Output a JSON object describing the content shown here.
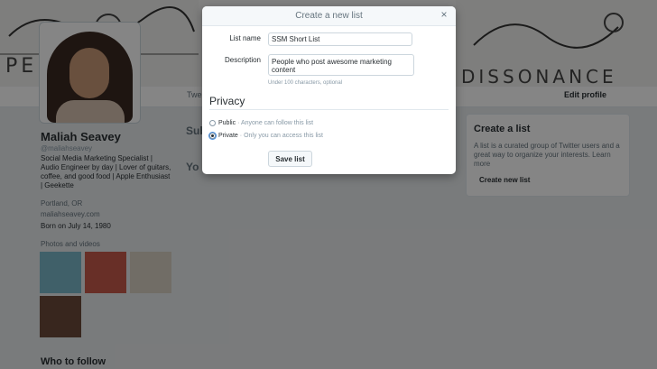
{
  "modal": {
    "title": "Create a new list",
    "close_glyph": "×",
    "list_name_label": "List name",
    "list_name_value": "SSM Short List",
    "description_label": "Description",
    "description_value": "People who post awesome marketing content",
    "description_hint": "Under 100 characters, optional",
    "privacy_title": "Privacy",
    "public_label": "Public",
    "public_sub": "· Anyone can follow this list",
    "private_label": "Private",
    "private_sub": "· Only you can access this list",
    "selected_privacy": "private",
    "save_label": "Save list"
  },
  "profile": {
    "name": "Maliah Seavey",
    "edit_profile_label": "Edit profile",
    "born": "Born on July 14, 1980",
    "who_to_follow": "Who to follow"
  },
  "sidebar_right": {
    "title": "Create a list",
    "text": "A list is a curated group of Twitter users and a great way to organize your interests. Learn more",
    "button": "Create new list"
  },
  "icons": {
    "close": "close-icon",
    "radio": "radio-icon"
  },
  "colors": {
    "overlay": "rgba(0,0,0,0.48)",
    "text": "#292f33",
    "muted": "#8899a6"
  }
}
